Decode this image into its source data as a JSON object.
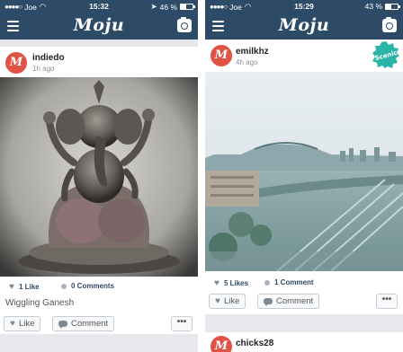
{
  "left": {
    "status": {
      "carrier": "Joe",
      "time": "15:32",
      "battery": "46 %",
      "battery_level": 0.46
    },
    "nav": {
      "logo": "Moju"
    },
    "post": {
      "avatar_letter": "M",
      "username": "indiedo",
      "time_ago": "1h ago",
      "likes": "1 Like",
      "comments": "0 Comments",
      "caption": "Wiggling Ganesh",
      "like_label": "Like",
      "comment_label": "Comment",
      "more_label": "•••"
    }
  },
  "right": {
    "status": {
      "carrier": "Joe",
      "time": "15:29",
      "battery": "43 %",
      "battery_level": 0.43
    },
    "nav": {
      "logo": "Moju"
    },
    "post": {
      "avatar_letter": "M",
      "username": "emilkhz",
      "time_ago": "4h ago",
      "badge": "Scenic",
      "likes": "5 Likes",
      "comments": "1 Comment",
      "like_label": "Like",
      "comment_label": "Comment",
      "more_label": "•••"
    },
    "next_post": {
      "avatar_letter": "M",
      "username": "chicks28"
    }
  },
  "colors": {
    "nav": "#2d4a66",
    "avatar": "#e05344",
    "badge": "#2bb5a8",
    "feed_bg": "#e6e8eb"
  }
}
